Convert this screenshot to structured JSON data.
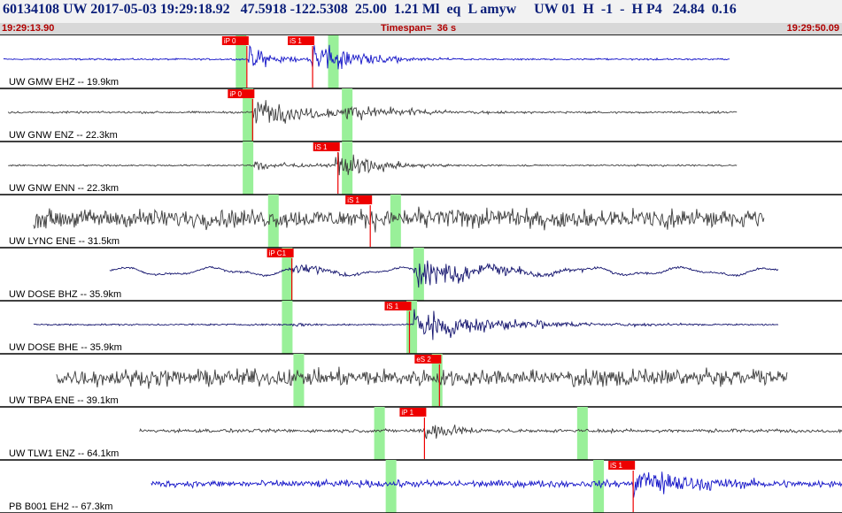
{
  "header": {
    "title": "60134108 UW 2017-05-03 19:29:18.92   47.5918 -122.5308  25.00  1.21 Ml  eq  L amyw     UW 01  H  -1  -  H P4   24.84  0.16"
  },
  "timebar": {
    "start": "19:29:13.90",
    "span": "Timespan=  36 s",
    "end": "19:29:50.09"
  },
  "colors": {
    "blue_trace": "#1515c8",
    "gray_trace": "#3d3d3d",
    "navy_trace": "#14146e",
    "window": "#99f099",
    "pick": "#ee0000",
    "divider": "#000000"
  },
  "traces": [
    {
      "label": "UW GMW EHZ -- 19.9km",
      "color": "blue",
      "start_sec": 0.0,
      "end_sec": 31.5,
      "noise": 0.05,
      "kind": "burst",
      "windows": [
        10.3,
        14.3
      ],
      "picks": [
        {
          "label": "iP 0",
          "sec": 10.55
        },
        {
          "label": "iS 1",
          "sec": 13.4
        }
      ],
      "events": [
        {
          "sec": 10.6,
          "amp": 0.5,
          "dur": 1.2
        },
        {
          "sec": 13.3,
          "amp": 0.7,
          "dur": 2.0
        }
      ]
    },
    {
      "label": "UW GNW ENZ -- 22.3km",
      "color": "gray",
      "start_sec": 0.2,
      "end_sec": 31.8,
      "noise": 0.06,
      "kind": "burst",
      "windows": [
        10.6,
        14.9
      ],
      "picks": [
        {
          "label": "iP 0",
          "sec": 10.8
        }
      ],
      "events": [
        {
          "sec": 10.8,
          "amp": 0.55,
          "dur": 3.0
        },
        {
          "sec": 14.8,
          "amp": 0.35,
          "dur": 2.5
        }
      ]
    },
    {
      "label": "UW GNW ENN -- 22.3km",
      "color": "gray",
      "start_sec": 0.2,
      "end_sec": 31.8,
      "noise": 0.05,
      "kind": "burst",
      "windows": [
        10.6,
        14.9
      ],
      "picks": [
        {
          "label": "iS 1",
          "sec": 14.5
        }
      ],
      "events": [
        {
          "sec": 10.8,
          "amp": 0.2,
          "dur": 2.0
        },
        {
          "sec": 14.4,
          "amp": 0.75,
          "dur": 1.6
        }
      ]
    },
    {
      "label": "UW LYNC ENE -- 31.5km",
      "color": "gray",
      "start_sec": 1.3,
      "end_sec": 33.0,
      "noise": 0.55,
      "kind": "noisy",
      "windows": [
        11.7,
        17.0
      ],
      "picks": [
        {
          "label": "iS 1",
          "sec": 15.9
        }
      ],
      "events": [
        {
          "sec": 15.9,
          "amp": 0.4,
          "dur": 0.5
        }
      ]
    },
    {
      "label": "UW DOSE BHZ -- 35.9km",
      "color": "navy",
      "start_sec": 4.6,
      "end_sec": 33.6,
      "noise": 0.06,
      "kind": "wavy",
      "windows": [
        12.3,
        18.0
      ],
      "picks": [
        {
          "label": "iP C1",
          "sec": 12.5
        }
      ],
      "events": [
        {
          "sec": 12.5,
          "amp": 0.3,
          "dur": 1.5
        },
        {
          "sec": 17.8,
          "amp": 0.6,
          "dur": 3.0
        }
      ]
    },
    {
      "label": "UW DOSE BHE -- 35.9km",
      "color": "navy",
      "start_sec": 1.3,
      "end_sec": 33.6,
      "noise": 0.05,
      "kind": "burst",
      "windows": [
        12.3,
        17.7
      ],
      "picks": [
        {
          "label": "iS 1",
          "sec": 17.6
        }
      ],
      "events": [
        {
          "sec": 12.4,
          "amp": 0.1,
          "dur": 1.0
        },
        {
          "sec": 17.8,
          "amp": 0.65,
          "dur": 3.5
        }
      ]
    },
    {
      "label": "UW TBPA ENE -- 39.1km",
      "color": "gray",
      "start_sec": 2.3,
      "end_sec": 34.0,
      "noise": 0.5,
      "kind": "noisy",
      "windows": [
        12.8,
        18.8
      ],
      "picks": [
        {
          "label": "eS 2",
          "sec": 18.9
        }
      ],
      "events": [
        {
          "sec": 18.9,
          "amp": 0.4,
          "dur": 0.6
        }
      ]
    },
    {
      "label": "UW TLW1 ENZ -- 64.1km",
      "color": "gray",
      "start_sec": 5.9,
      "end_sec": 37.5,
      "noise": 0.1,
      "kind": "burst",
      "windows": [
        16.3,
        25.1
      ],
      "picks": [
        {
          "label": "iP 1",
          "sec": 18.25
        }
      ],
      "events": [
        {
          "sec": 18.2,
          "amp": 0.55,
          "dur": 1.2
        }
      ]
    },
    {
      "label": "PB B001 EH2 -- 67.3km",
      "color": "blue",
      "start_sec": 6.4,
      "end_sec": 38.0,
      "noise": 0.2,
      "kind": "burst",
      "windows": [
        16.8,
        25.8
      ],
      "picks": [
        {
          "label": "iS 1",
          "sec": 27.3
        }
      ],
      "events": [
        {
          "sec": 27.3,
          "amp": 0.8,
          "dur": 2.5
        }
      ]
    }
  ]
}
